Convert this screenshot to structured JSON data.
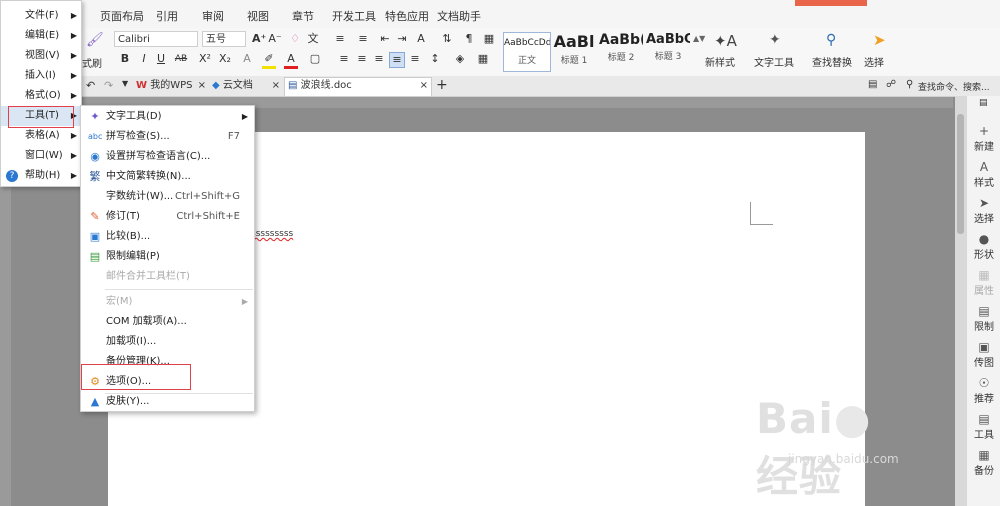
{
  "ribbon_tabs": [
    "页面布局",
    "引用",
    "审阅",
    "视图",
    "章节",
    "开发工具",
    "特色应用",
    "文档助手"
  ],
  "ribbon": {
    "format_painter": "式刷",
    "font_name": "Calibri",
    "font_size": "五号",
    "bold": "B",
    "italic": "I",
    "underline": "U",
    "styles": [
      {
        "sample": "AaBbCcDd",
        "name": "正文"
      },
      {
        "sample": "AaBl",
        "name": "标题 1"
      },
      {
        "sample": "AaBb(",
        "name": "标题 2"
      },
      {
        "sample": "AaBbC",
        "name": "标题 3"
      }
    ],
    "new_style": "新样式",
    "text_tools": "文字工具",
    "find_replace": "查找替换",
    "select": "选择"
  },
  "doc_tabs": [
    {
      "label": "我的WPS"
    },
    {
      "label": "云文档"
    },
    {
      "label": "波浪线.doc"
    }
  ],
  "search_placeholder": "查找命令、搜索...",
  "doc_text": "sssssssss",
  "left_menu": [
    {
      "label": "文件(F)",
      "arrow": true
    },
    {
      "label": "编辑(E)",
      "arrow": true
    },
    {
      "label": "视图(V)",
      "arrow": true
    },
    {
      "label": "插入(I)",
      "arrow": true
    },
    {
      "label": "格式(O)",
      "arrow": true
    },
    {
      "label": "工具(T)",
      "arrow": true
    },
    {
      "label": "表格(A)",
      "arrow": true
    },
    {
      "label": "窗口(W)",
      "arrow": true
    },
    {
      "label": "帮助(H)",
      "arrow": true
    }
  ],
  "tools_menu": [
    {
      "label": "文字工具(D)",
      "shortcut": "",
      "arrow": true
    },
    {
      "label": "拼写检查(S)...",
      "shortcut": "F7"
    },
    {
      "label": "设置拼写检查语言(C)...",
      "shortcut": ""
    },
    {
      "label": "中文简繁转换(N)...",
      "shortcut": ""
    },
    {
      "label": "字数统计(W)...",
      "shortcut": "Ctrl+Shift+G"
    },
    {
      "label": "修订(T)",
      "shortcut": "Ctrl+Shift+E"
    },
    {
      "label": "比较(B)...",
      "shortcut": ""
    },
    {
      "label": "限制编辑(P)",
      "shortcut": ""
    },
    {
      "label": "邮件合并工具栏(T)",
      "shortcut": ""
    },
    {
      "label": "宏(M)",
      "shortcut": "",
      "arrow": true
    },
    {
      "label": "COM 加载项(A)...",
      "shortcut": ""
    },
    {
      "label": "加载项(I)...",
      "shortcut": ""
    },
    {
      "label": "备份管理(K)...",
      "shortcut": ""
    },
    {
      "label": "选项(O)...",
      "shortcut": ""
    },
    {
      "label": "皮肤(Y)...",
      "shortcut": ""
    }
  ],
  "sidebar": [
    "新建",
    "样式",
    "选择",
    "形状",
    "属性",
    "限制",
    "传图",
    "推荐",
    "工具",
    "备份"
  ],
  "watermark": {
    "brand": "Bai",
    "brand2": "经验",
    "url": "jingyan.baidu.com"
  },
  "colors": {
    "accent": "#2b579a",
    "highlight": "#e0404a",
    "menu_hover": "#dbe6f4"
  }
}
